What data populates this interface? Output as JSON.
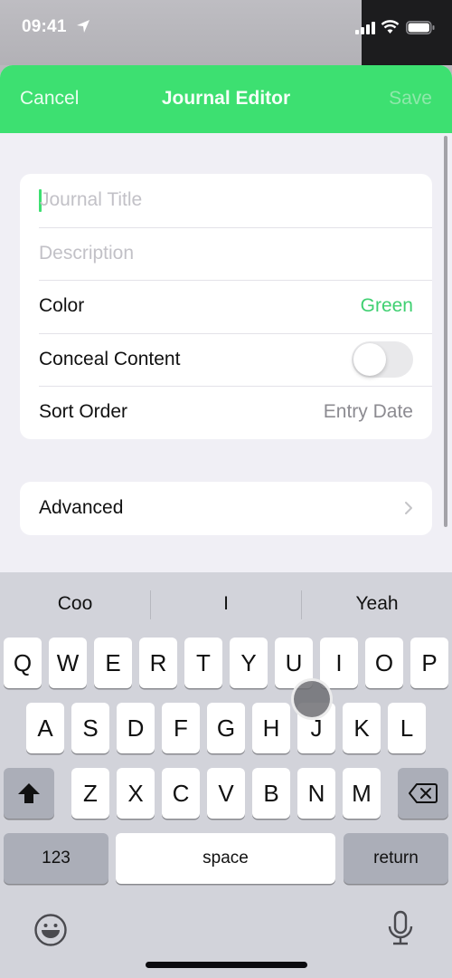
{
  "status_bar": {
    "time": "09:41"
  },
  "nav": {
    "cancel": "Cancel",
    "title": "Journal Editor",
    "save": "Save"
  },
  "form": {
    "title_placeholder": "Journal Title",
    "description_placeholder": "Description",
    "color_label": "Color",
    "color_value": "Green",
    "conceal_label": "Conceal Content",
    "conceal_enabled": false,
    "sort_label": "Sort Order",
    "sort_value": "Entry Date",
    "advanced_label": "Advanced"
  },
  "keyboard": {
    "suggestions": [
      "Coo",
      "I",
      "Yeah"
    ],
    "row1": [
      "Q",
      "W",
      "E",
      "R",
      "T",
      "Y",
      "U",
      "I",
      "O",
      "P"
    ],
    "row2": [
      "A",
      "S",
      "D",
      "F",
      "G",
      "H",
      "J",
      "K",
      "L"
    ],
    "row3": [
      "Z",
      "X",
      "C",
      "V",
      "B",
      "N",
      "M"
    ],
    "numbers": "123",
    "space": "space",
    "return": "return"
  },
  "colors": {
    "accent": "#3de071",
    "value_green": "#3fd071"
  }
}
